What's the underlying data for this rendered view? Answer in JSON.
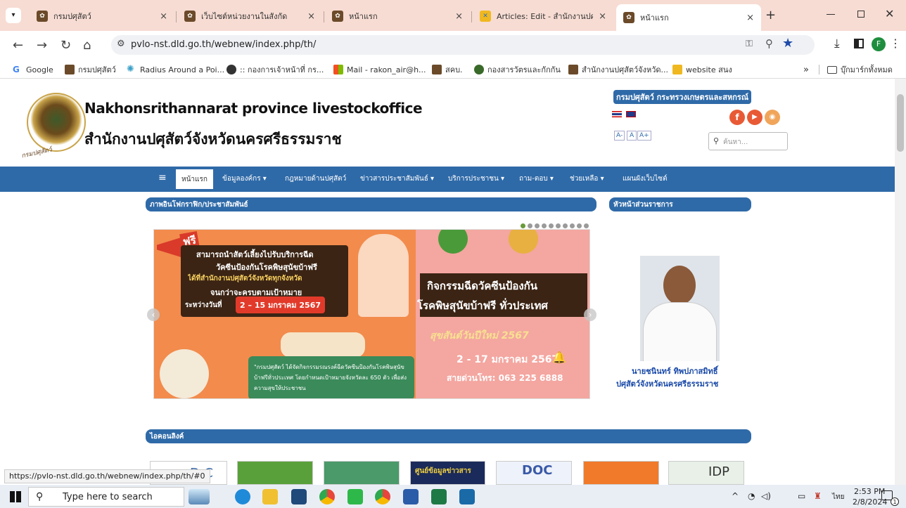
{
  "browser": {
    "tabs": [
      {
        "title": "กรมปศุสัตว์",
        "active": false
      },
      {
        "title": "เว็บไซต์หน่วยงานในสังกัด",
        "active": false
      },
      {
        "title": "หน้าแรก",
        "active": false
      },
      {
        "title": "Articles: Edit - สำนักงานปศุสัตว์",
        "active": false
      },
      {
        "title": "หน้าแรก",
        "active": true
      }
    ],
    "close_glyph": "×",
    "new_tab": "+",
    "url": "pvlo-nst.dld.go.th/webnew/index.php/th/",
    "bookmarks": [
      {
        "label": "Google",
        "icon": "google-icon"
      },
      {
        "label": "กรมปศุสัตว์",
        "icon": "dld-icon"
      },
      {
        "label": "Radius Around a Poi...",
        "icon": "radius-icon"
      },
      {
        "label": ":: กองการเจ้าหน้าที่ กร...",
        "icon": "globe-icon"
      },
      {
        "label": "Mail - rakon_air@h...",
        "icon": "mail-icon"
      },
      {
        "label": "สคบ.",
        "icon": "dld-icon"
      },
      {
        "label": "กองสารวัตรและกักกัน",
        "icon": "dld-icon"
      },
      {
        "label": "สำนักงานปศุสัตว์จังหวัด...",
        "icon": "dld-icon"
      },
      {
        "label": "website สนง",
        "icon": "joomla-icon"
      }
    ],
    "bookmarks_more": "»",
    "all_bookmarks": "บุ๊กมาร์กทั้งหมด",
    "profile_letter": "F"
  },
  "site": {
    "title_en": "Nakhonsrithannarat province livestockoffice",
    "title_th": "สำนักงานปศุสัตว์จังหวัดนครศรีธรรมราช",
    "logo_caption": "กรมปศุสัตว์",
    "ministry": "กรมปศุสัตว์ กระทรวงเกษตรและสหกรณ์",
    "font_sizes": [
      "A-",
      "A",
      "A+"
    ],
    "search_placeholder": "ค้นหา..."
  },
  "menu": {
    "items": [
      "หน้าแรก",
      "ข้อมูลองค์กร ▾",
      "กฎหมายด้านปศุสัตว์",
      "ข่าวสารประชาสัมพันธ์ ▾",
      "บริการประชาชน ▾",
      "ถาม-ตอบ ▾",
      "ช่วยเหลือ ▾",
      "แผนผังเว็บไซต์"
    ]
  },
  "sections": {
    "gallery": "ภาพอินโฟกราฟิก/ประชาสัมพันธ์",
    "head": "หัวหน้าส่วนราชการ",
    "links": "ไอคอนลิงค์"
  },
  "banner": {
    "free": "ฟรี",
    "line1": "สามารถนำสัตว์เลี้ยงไปรับบริการฉีด",
    "line2": "วัคซีนป้องกันโรคพิษสุนัขบ้าฟรี",
    "line3": "ได้ที่สำนักงานปศุสัตว์จังหวัดทุกจังหวัด",
    "line4": "จนกว่าจะครบตามเป้าหมาย",
    "period_label": "ระหว่างวันที่",
    "period": "2 – 15 มกราคม 2567",
    "headline1": "กิจกรรมฉีดวัคซีนป้องกัน",
    "headline2": "โรคพิษสุนัขบ้าฟรี ทั่วประเทศ",
    "newyear": "สุขสันต์วันปีใหม่ 2567",
    "date2": "2 - 17 มกราคม 2567",
    "hotline": "สายด่วนโทร: 063 225 6888",
    "note": "\"กรมปศุสัตว์ ได้จัดกิจกรรมรณรงค์ฉีดวัคซีนป้องกันโรคพิษสุนัขบ้าฟรีทั่วประเทศ โดยกำหนดเป้าหมายจังหวัดละ 650 ตัว เพื่อส่งความสุขให้ประชาชน",
    "slide_count": 10,
    "active_slide": 1
  },
  "director": {
    "name": "นายชนินทร์ ทิพปภาสมิทธิ์",
    "position": "ปศุสัตว์จังหวัดนครศรีธรรมราช"
  },
  "icon_links": [
    "D-C",
    "",
    "",
    "ศูนย์ข้อมูลข่าวสาร",
    "DOC",
    "",
    "IDP"
  ],
  "status_url": "https://pvlo-nst.dld.go.th/webnew/index.php/th/#0",
  "taskbar": {
    "search_placeholder": "Type here to search",
    "time": "2:53 PM",
    "date": "2/8/2024",
    "lang": "ไทย",
    "notify_count": "1"
  },
  "colors": {
    "menu_blue": "#2f6aa8",
    "tabbar": "#f7dcd3",
    "banner_orange": "#f28b4c",
    "banner_pink": "#f4a6a0"
  }
}
